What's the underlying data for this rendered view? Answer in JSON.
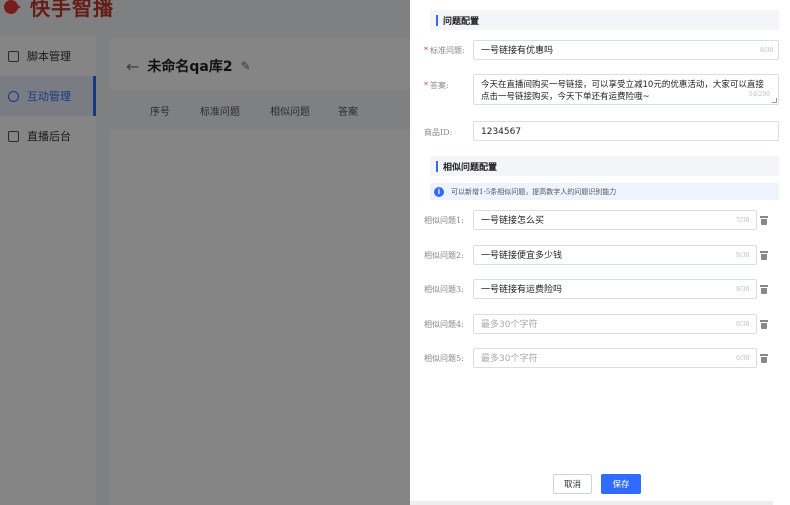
{
  "app": {
    "logo_text": "快手智播",
    "nav": [
      {
        "label": "脚本管理",
        "icon": "script-icon"
      },
      {
        "label": "互动管理",
        "icon": "interaction-icon"
      },
      {
        "label": "直播后台",
        "icon": "live-backend-icon"
      }
    ],
    "page_title": "未命名qa库2",
    "table_headers": [
      "序号",
      "标准问题",
      "相似问题",
      "答案"
    ]
  },
  "drawer": {
    "question_section": "问题配置",
    "standard_question": {
      "label": "标准问题:",
      "value": "一号链接有优惠吗",
      "counter": "8/30"
    },
    "answer": {
      "label": "答案:",
      "value": "今天在直播间购买一号链接，可以享受立减10元的优惠活动，大家可以直接点击一号链接购买，今天下单还有运费险哦~",
      "counter": "54/200"
    },
    "product_id": {
      "label": "商品ID:",
      "value": "1234567"
    },
    "similar_section": "相似问题配置",
    "info_text": "可以新增1-5条相似问题，提高数字人的问题识别能力",
    "similar_questions": [
      {
        "label": "相似问题1:",
        "value": "一号链接怎么买",
        "counter": "7/30"
      },
      {
        "label": "相似问题2:",
        "value": "一号链接便宜多少钱",
        "counter": "9/30"
      },
      {
        "label": "相似问题3:",
        "value": "一号链接有运费险吗",
        "counter": "9/30"
      },
      {
        "label": "相似问题4:",
        "value": "",
        "placeholder": "最多30个字符",
        "counter": "0/30"
      },
      {
        "label": "相似问题5:",
        "value": "",
        "placeholder": "最多30个字符",
        "counter": "0/30"
      }
    ],
    "cancel_label": "取消",
    "save_label": "保存"
  },
  "colors": {
    "primary": "#2f6bff",
    "required": "#e53935",
    "brand": "#c0392b"
  }
}
